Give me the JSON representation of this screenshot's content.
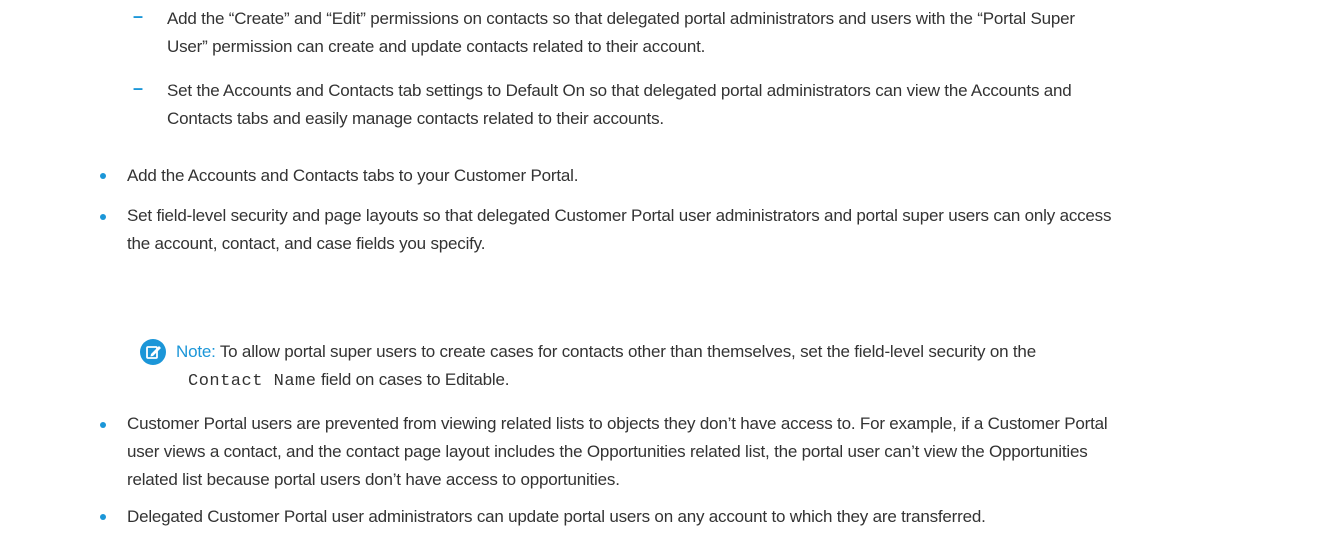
{
  "subitems": [
    {
      "marker": "–",
      "line1": "Add the “Create” and “Edit” permissions on contacts so that delegated portal administrators and users with the “Portal Super",
      "line2": "User” permission can create and update contacts related to their account."
    },
    {
      "marker": "–",
      "line1": "Set the Accounts and Contacts tab settings to Default On so that delegated portal administrators can view the Accounts and",
      "line2": "Contacts tabs and easily manage contacts related to their accounts."
    }
  ],
  "bullets": [
    {
      "line1": "Add the Accounts and Contacts tabs to your Customer Portal."
    },
    {
      "line1": "Set field-level security and page layouts so that delegated Customer Portal user administrators and portal super users can only access",
      "line2": "the account, contact, and case fields you specify."
    },
    {
      "line1": "Customer Portal users are prevented from viewing related lists to objects they don’t have access to. For example, if a Customer Portal",
      "line2": "user views a contact, and the contact page layout includes the Opportunities related list, the portal user can’t view the Opportunities",
      "line3": "related list because portal users don’t have access to opportunities."
    },
    {
      "line1": "Delegated Customer Portal user administrators can update portal users on any account to which they are transferred."
    }
  ],
  "note": {
    "icon": "edit-note-icon",
    "label": "Note:",
    "text1": "To allow portal super users to create cases for contacts other than themselves, set the field-level security on the",
    "code": "Contact Name",
    "text2": "field on cases to Editable."
  },
  "colors": {
    "accent": "#1b96d8",
    "text": "#333333"
  }
}
